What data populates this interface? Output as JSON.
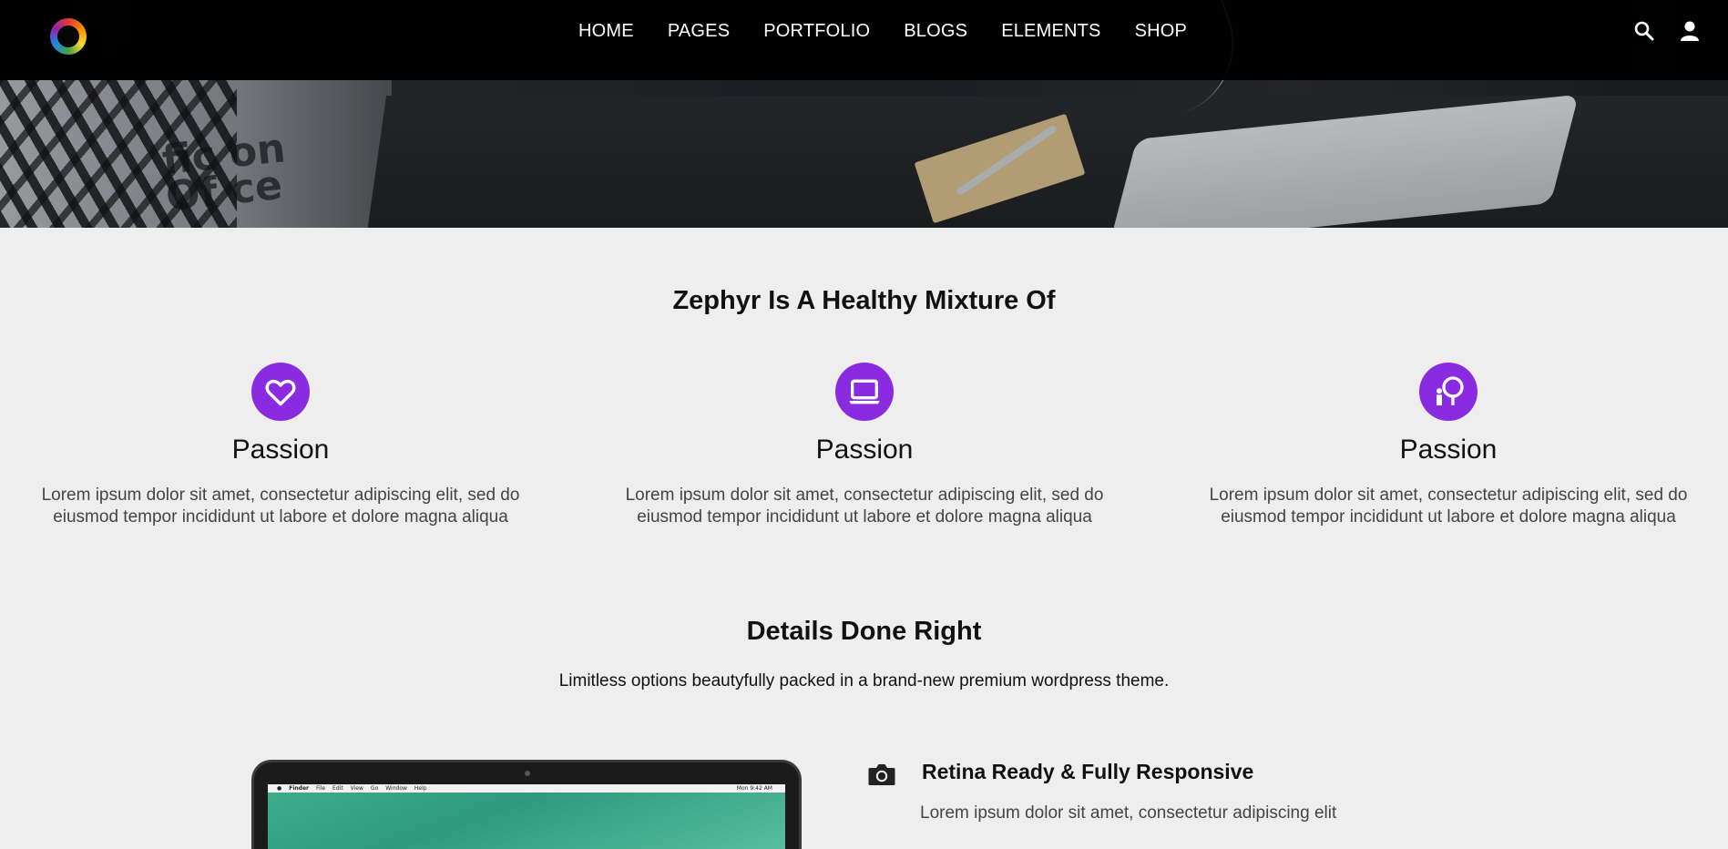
{
  "nav": {
    "items": [
      "HOME",
      "PAGES",
      "PORTFOLIO",
      "BLOGS",
      "ELEMENTS",
      "SHOP"
    ],
    "icons": [
      "search-icon",
      "user-icon"
    ],
    "logo": "brand-logo"
  },
  "hero": {
    "wall_text": "fic on\nOf ce"
  },
  "mixture": {
    "title": "Zephyr Is A Healthy Mixture Of",
    "features": [
      {
        "icon": "heart-icon",
        "title": "Passion",
        "text": "Lorem ipsum dolor sit amet, consectetur adipiscing elit, sed do eiusmod tempor incididunt ut labore et dolore magna aliqua"
      },
      {
        "icon": "laptop-icon",
        "title": "Passion",
        "text": "Lorem ipsum dolor sit amet, consectetur adipiscing elit, sed do eiusmod tempor incididunt ut labore et dolore magna aliqua"
      },
      {
        "icon": "presentation-icon",
        "title": "Passion",
        "text": "Lorem ipsum dolor sit amet, consectetur adipiscing elit, sed do eiusmod tempor incididunt ut labore et dolore magna aliqua"
      }
    ],
    "accent_color": "#8a2be2"
  },
  "details": {
    "title": "Details Done Right",
    "subtitle": "Limitless options beautyfully packed in a brand-new premium wordpress theme.",
    "items": [
      {
        "icon": "camera-icon",
        "title": "Retina Ready & Fully Responsive",
        "text": "Lorem ipsum dolor sit amet, consectetur adipiscing elit"
      }
    ],
    "mac_menubar": [
      "Finder",
      "File",
      "Edit",
      "View",
      "Go",
      "Window",
      "Help"
    ],
    "mac_status": "Mon 9:42 AM"
  }
}
